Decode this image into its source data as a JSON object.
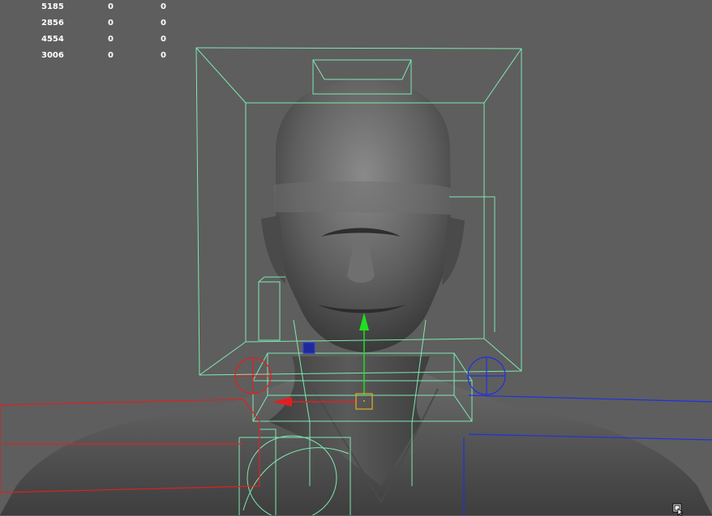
{
  "hud": {
    "rows": [
      [
        "5185",
        "0",
        "0"
      ],
      [
        "2856",
        "0",
        "0"
      ],
      [
        "4554",
        "0",
        "0"
      ],
      [
        "3006",
        "0",
        "0"
      ]
    ]
  },
  "colors": {
    "background": "#5e5e5e",
    "wireframe": "#7fe8b0",
    "axis_x": "#e02020",
    "axis_y": "#20e020",
    "axis_z": "#2020e0",
    "pivot": "#e0b020"
  },
  "icons": {
    "move_manipulator": "move-manipulator-icon",
    "cursor": "mouse-cursor-icon"
  }
}
